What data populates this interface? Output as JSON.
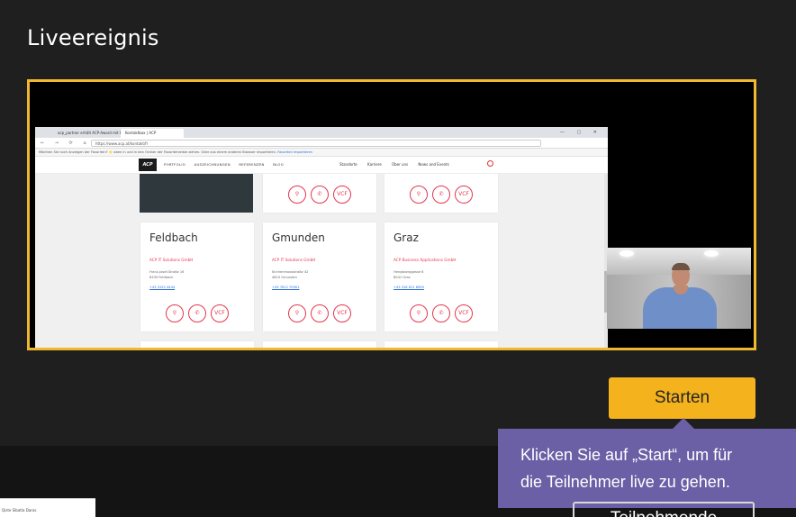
{
  "page": {
    "title": "Liveereignis",
    "start_button": "Starten",
    "tooltip_line1": "Klicken Sie auf „Start“, um für",
    "tooltip_line2": "die Teilnehmer live zu gehen.",
    "secondary_button": "Teilnehmende",
    "thumbnail_text": "Qiste Sibatla Daras"
  },
  "colors": {
    "accent": "#f4b21d",
    "preview_border": "#f1b82e",
    "tooltip": "#6b5fa6",
    "background": "#1f1f1f",
    "acp_red": "#e2384f"
  },
  "browser": {
    "tab1": "acp_partner erhält ACP-Award mit Preis",
    "tab2": "Kontaktbox | ACP",
    "url": "https://www.acp.at/kontakt/fr",
    "info_text": "Möchten Sie noch Anzeigen der Favoriten? ⭐ oben in und in den Ordner der Favoritenleiste ziehen. Oder aus einem anderen Browser importieren.",
    "info_link": "Favoriten importieren",
    "logo": "ACP",
    "menu": [
      "PORTFOLIO",
      "AUSZEICHNUNGEN",
      "REFERENZEN",
      "BLOG"
    ],
    "right_menu": [
      "Standorte",
      "Karriere",
      "Über uns",
      "News and Events"
    ]
  },
  "locations": [
    {
      "city": "Feldbach",
      "company": "ACP IT Solutions GmbH",
      "address_line1": "Franz-Josef-Straße 16",
      "address_line2": "8330 Feldbach",
      "phone": "+43 3152 4444"
    },
    {
      "city": "Gmunden",
      "company": "ACP IT Solutions GmbH",
      "address_line1": "Kirchenmoosstraße 42",
      "address_line2": "4810 Gmunden",
      "phone": "+43 7612 70901"
    },
    {
      "city": "Graz",
      "company": "ACP Business Applications GmbH",
      "address_line1": "Hengsberggasse 6",
      "address_line2": "8041 Graz",
      "phone": "+43 316 811 8900"
    }
  ],
  "contact_icons": [
    "location-pin-icon",
    "phone-icon",
    "vcf-icon"
  ],
  "contact_icon_labels": [
    "⚲",
    "✆",
    "VCF"
  ]
}
